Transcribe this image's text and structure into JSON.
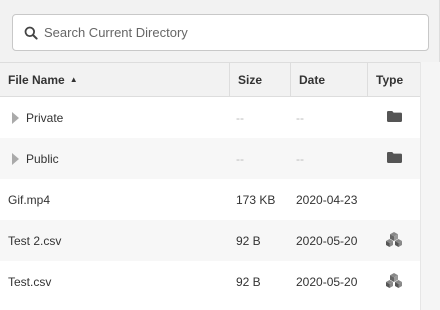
{
  "search": {
    "placeholder": "Search Current Directory"
  },
  "columns": {
    "name": "File Name",
    "size": "Size",
    "date": "Date",
    "type": "Type"
  },
  "rows": [
    {
      "name": "Private",
      "size": "--",
      "date": "--",
      "kind": "folder",
      "type_icon": "folder-icon"
    },
    {
      "name": "Public",
      "size": "--",
      "date": "--",
      "kind": "folder",
      "type_icon": "folder-icon"
    },
    {
      "name": "Gif.mp4",
      "size": "173 KB",
      "date": "2020-04-23",
      "kind": "file",
      "type_icon": ""
    },
    {
      "name": "Test 2.csv",
      "size": "92 B",
      "date": "2020-05-20",
      "kind": "file",
      "type_icon": "dataset-icon"
    },
    {
      "name": "Test.csv",
      "size": "92 B",
      "date": "2020-05-20",
      "kind": "file",
      "type_icon": "dataset-icon"
    }
  ]
}
